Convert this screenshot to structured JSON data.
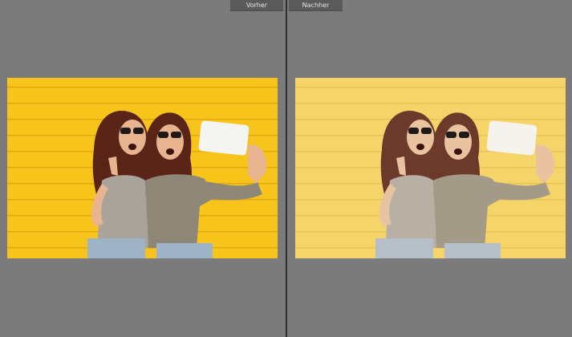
{
  "compare_view": {
    "before_label": "Vorher",
    "after_label": "Nachher"
  },
  "photo": {
    "subject": "two-women-selfie",
    "before_palette": {
      "wall": "#f6c41a",
      "wall_line": "#e2a90d",
      "hair": "#5a2417",
      "skin": "#e8b38f",
      "shirt_gray": "#a9a39b",
      "shirt_olive": "#8e8777",
      "jeans": "#9fb3c7",
      "phone": "#f4f4f2"
    },
    "after_palette": {
      "wall": "#f5d469",
      "wall_line": "#e9c25a",
      "hair": "#6b3a2a",
      "skin": "#e9c3a0",
      "shirt_gray": "#b8b0a5",
      "shirt_olive": "#a39a88",
      "jeans": "#b6bfc7",
      "phone": "#f6f3ec"
    }
  }
}
